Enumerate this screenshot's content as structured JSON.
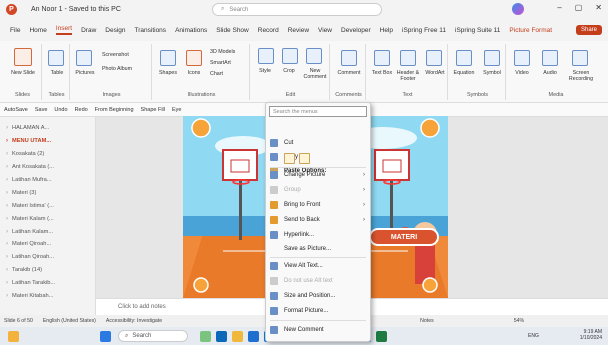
{
  "titlebar": {
    "title": "An Noor 1 - Saved to this PC",
    "search_placeholder": "Search",
    "minimize": "–",
    "restore": "▢",
    "close": "✕"
  },
  "menu": [
    "File",
    "Home",
    "Insert",
    "Draw",
    "Design",
    "Transitions",
    "Animations",
    "Slide Show",
    "Record",
    "Review",
    "View",
    "Developer",
    "Help",
    "iSpring Free 11",
    "iSpring Suite 11",
    "Picture Format"
  ],
  "share_label": "Share",
  "ribbon": {
    "new_slide": "New Slide",
    "table": "Table",
    "pictures": "Pictures",
    "screenshot": "Screenshot",
    "photo_album": "Photo Album",
    "shapes": "Shapes",
    "icons": "Icons",
    "models": "3D Models",
    "smartart": "SmartArt",
    "chart": "Chart",
    "style": "Style",
    "crop": "Crop",
    "new_comment": "New Comment",
    "comment": "Comment",
    "textbox": "Text Box",
    "header_footer": "Header & Footer",
    "wordart": "WordArt",
    "equation": "Equation",
    "symbol": "Symbol",
    "video": "Video",
    "audio": "Audio",
    "screen_recording": "Screen Recording",
    "groups": [
      "Slides",
      "Tables",
      "Images",
      "Illustrations",
      "Edit",
      "Comments",
      "Text",
      "Symbols",
      "Media"
    ]
  },
  "qat": [
    "AutoSave",
    "Save",
    "Undo",
    "Redo",
    "From Beginning",
    "Shape Fill",
    "Eye"
  ],
  "sections": [
    "HALAMAN A...",
    "MENU UTAM...",
    "Kosakata (2)",
    "Ant Kosakata (...",
    "Latihan Mufra...",
    "Materi (3)",
    "Materi Istima' (...",
    "Materi Kalam (...",
    "Latihan Kalam...",
    "Materi Qiroah...",
    "Latihan Qiroah...",
    "Tarakib (14)",
    "Latihan Tarakib...",
    "Materi Kitabah..."
  ],
  "selected_section": 1,
  "notes_placeholder": "Click to add notes",
  "status": {
    "slide": "Slide 6 of 50",
    "lang": "English (United States)",
    "accessibility": "Accessibility: Investigate",
    "notes": "Notes",
    "zoom": "54%"
  },
  "slide": {
    "button": "MATERI"
  },
  "context_menu": {
    "search_placeholder": "Search the menus",
    "items": [
      "Cut",
      "Copy",
      "Paste Options:",
      "Change Picture",
      "Group",
      "Bring to Front",
      "Send to Back",
      "Hyperlink...",
      "Save as Picture...",
      "View Alt Text...",
      "Do not use Alt text",
      "Size and Position...",
      "Format Picture...",
      "New Comment"
    ]
  },
  "taskbar": {
    "search": "Search",
    "time": "9:19 AM",
    "date": "1/10/2024",
    "lang": "ENG"
  }
}
